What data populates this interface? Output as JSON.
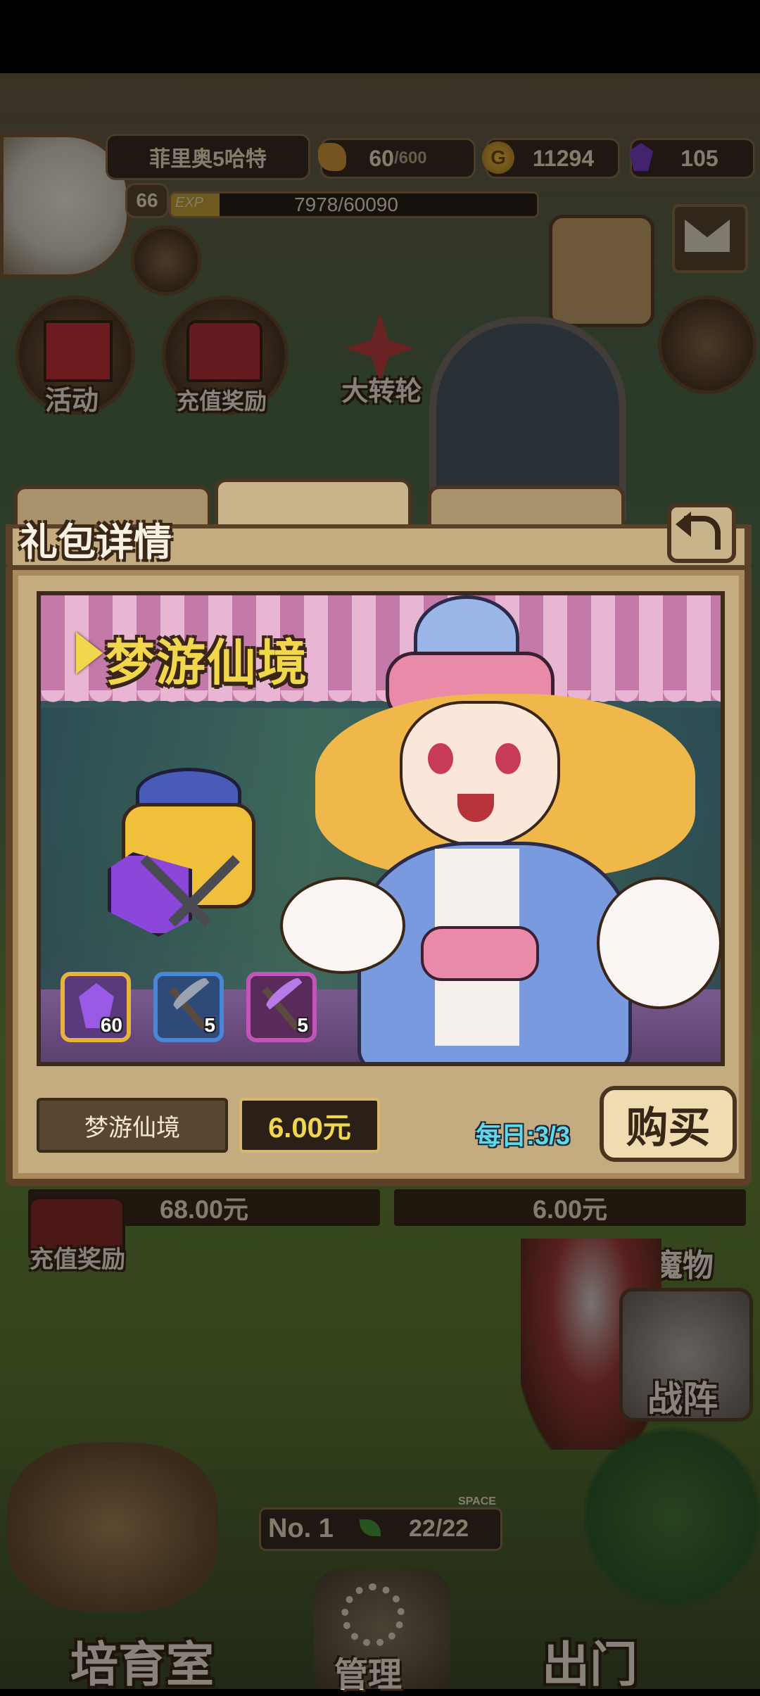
{
  "player": {
    "name": "菲里奥5哈特",
    "level": "66",
    "exp_label": "EXP",
    "exp_text": "7978/60090",
    "exp_fraction": 0.133
  },
  "resources": {
    "stamina_value": "60",
    "stamina_max": "/600",
    "gold": "11294",
    "gems": "105"
  },
  "menu": {
    "activity": "活动",
    "recharge_reward": "充值奖励",
    "wheel": "大转轮"
  },
  "dialog": {
    "title": "礼包详情",
    "banner_title": "梦游仙境",
    "items": [
      {
        "icon": "purple-gem-icon",
        "count": "60",
        "color": "#e6b43c"
      },
      {
        "icon": "pickaxe-icon",
        "count": "5",
        "color": "#4a86d8"
      },
      {
        "icon": "purple-pickaxe-icon",
        "count": "5",
        "color": "#c256b8"
      }
    ],
    "pack_name": "梦游仙境",
    "price": "6.00元",
    "daily_limit": "每日:3/3",
    "buy_label": "购买"
  },
  "behind": {
    "price_left": "68.00元",
    "price_right": "6.00元",
    "recharge_reward": "充值奖励",
    "monster": "魔物",
    "formation": "战阵",
    "rank": "No. 1",
    "space_label": "SPACE",
    "space": "22/22",
    "nursery": "培育室",
    "manage": "管理",
    "go_out": "出门"
  },
  "colors": {
    "gold_text": "#f2d64c",
    "cyan_text": "#5fd8e8",
    "frame": "#5a4128"
  }
}
